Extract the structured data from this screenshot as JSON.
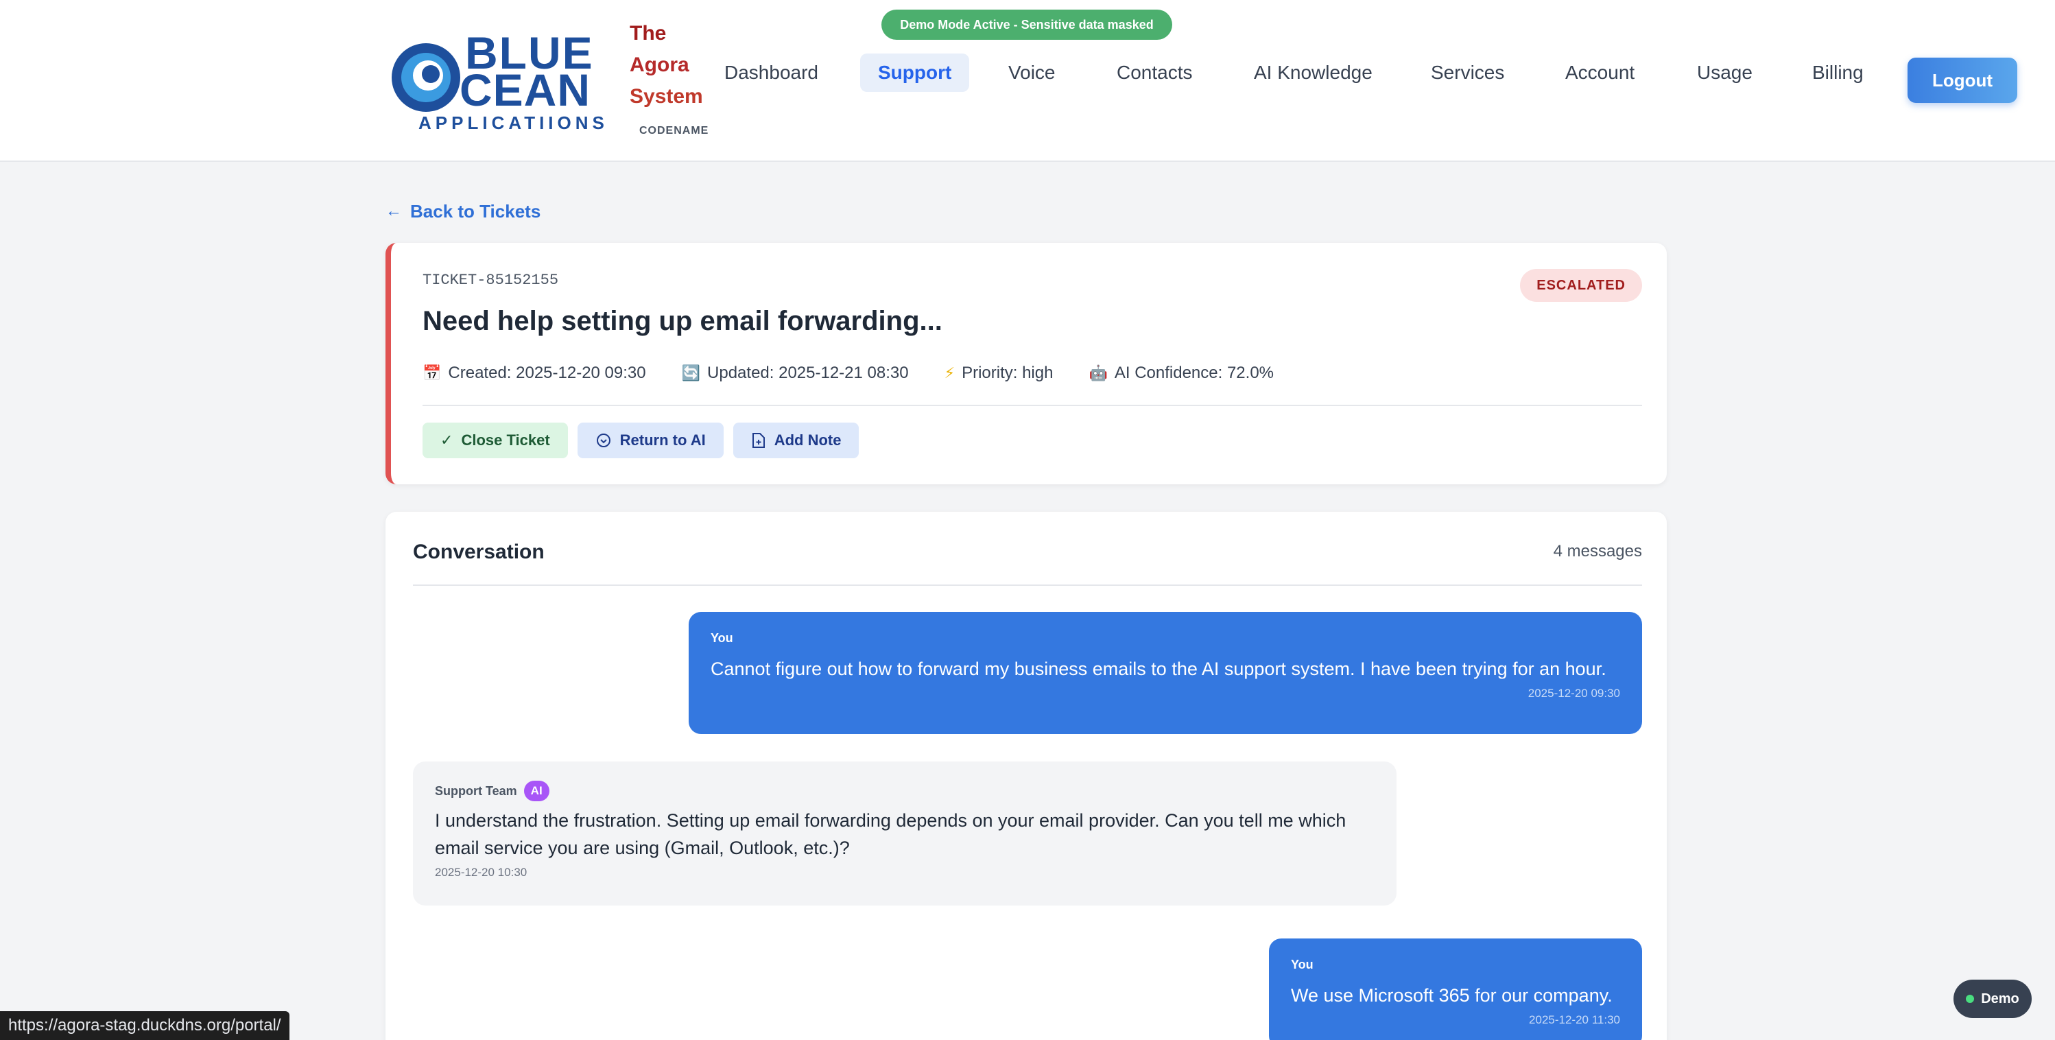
{
  "demo_banner": "Demo Mode Active - Sensitive data masked",
  "logo": {
    "line1": "BLUE",
    "line2": "CEAN",
    "line3": "APPLICATIIONS"
  },
  "agora": {
    "line1": "The",
    "line2": "Agora",
    "line3": "System",
    "codename": "CODENAME"
  },
  "nav": {
    "items": [
      {
        "label": "Dashboard"
      },
      {
        "label": "Support"
      },
      {
        "label": "Voice"
      },
      {
        "label": "Contacts"
      },
      {
        "label": "AI Knowledge"
      },
      {
        "label": "Services"
      },
      {
        "label": "Account"
      },
      {
        "label": "Usage"
      },
      {
        "label": "Billing"
      }
    ],
    "active": "Support",
    "logout": "Logout"
  },
  "back_link": "Back to Tickets",
  "ticket": {
    "id": "TICKET-85152155",
    "title": "Need help setting up email forwarding...",
    "status": "ESCALATED",
    "created": "Created: 2025-12-20 09:30",
    "updated": "Updated: 2025-12-21 08:30",
    "priority": "Priority: high",
    "ai_confidence": "AI Confidence: 72.0%",
    "actions": {
      "close": "Close Ticket",
      "return_ai": "Return to AI",
      "add_note": "Add Note"
    }
  },
  "conversation": {
    "title": "Conversation",
    "count": "4 messages",
    "messages": [
      {
        "sender": "You",
        "body": "Cannot figure out how to forward my business emails to the AI support system. I have been trying for an hour.",
        "time": "2025-12-20 09:30"
      },
      {
        "sender": "Support Team",
        "badge": "AI",
        "body": "I understand the frustration. Setting up email forwarding depends on your email provider. Can you tell me which email service you are using (Gmail, Outlook, etc.)?",
        "time": "2025-12-20 10:30"
      },
      {
        "sender": "You",
        "body": "We use Microsoft 365 for our company.",
        "time": "2025-12-20 11:30"
      }
    ]
  },
  "status_url": "https://agora-stag.duckdns.org/portal/",
  "demo_chip": "Demo",
  "colors": {
    "primary": "#3478e0",
    "escalated_border": "#e05252",
    "demo_green": "#4caf6e",
    "ai_badge": "#a855f7"
  }
}
